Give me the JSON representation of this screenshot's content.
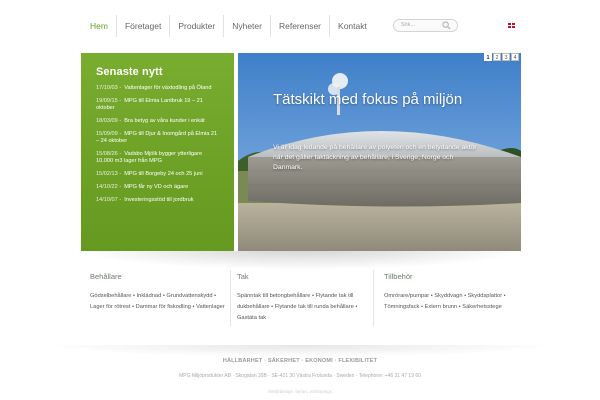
{
  "nav": {
    "items": [
      {
        "label": "Hem",
        "active": true
      },
      {
        "label": "Företaget",
        "active": false
      },
      {
        "label": "Produkter",
        "active": false
      },
      {
        "label": "Nyheter",
        "active": false
      },
      {
        "label": "Referenser",
        "active": false
      },
      {
        "label": "Kontakt",
        "active": false
      }
    ],
    "search_placeholder": "Sök...",
    "language_flag": "uk-flag-icon",
    "accent_color": "#6aa02b"
  },
  "news": {
    "title": "Senaste nytt",
    "background_color": "#6fa626",
    "items": [
      {
        "date": "17/10/03 -",
        "text": "Vattenlager för växtodling på Öland"
      },
      {
        "date": "19/09/15 -",
        "text": "MPG till Elmia Lantbruk 19 – 21 oktober"
      },
      {
        "date": "18/03/09 -",
        "text": "Bra betyg av våra kunder i enkät"
      },
      {
        "date": "15/09/09 -",
        "text": "MPG till Djur & Inomgård på Elmia 21 – 24 oktober"
      },
      {
        "date": "15/08/26 -",
        "text": "Vadsbo Mjölk bygger ytterligare 10.000 m3 lager från MPG"
      },
      {
        "date": "15/02/13 -",
        "text": "MPG till Borgeby 24 och 25 juni"
      },
      {
        "date": "14/10/22 -",
        "text": "MPG får ny VD och ägare"
      },
      {
        "date": "14/10/07 -",
        "text": "Investeringsstöd till jordbruk"
      }
    ]
  },
  "hero": {
    "title": "Tätskikt med fokus på miljön",
    "text": "Vi är idag ledande på behållare av polyeten och en betydande aktör när det gäller taktäckning av behållare, i Sverige, Norge och Danmark.",
    "pages": [
      "1",
      "2",
      "3",
      "4"
    ],
    "active_page": "1"
  },
  "columns": [
    {
      "title": "Behållare",
      "text": "Gödselbehållare • Inklädnad • Grundvattenskydd • Lager för rötrest • Dammar för fiskodling • Vattenlager"
    },
    {
      "title": "Tak",
      "text": "Spänntak till betongbehållare • Flytande tak till dukbehållare • Flytande tak till runda behållare • Gastäta tak"
    },
    {
      "title": "Tillbehör",
      "text": "Omrörare/pumpar • Skyddvagn • Skyddsplattor • Tömningsfack • Extern brunn • Säkerhetsstege"
    }
  ],
  "footer": {
    "tagline": "HÅLLBARHET · SÄKERHET · EKONOMI · FLEXIBILITET",
    "address": "MPG Miljöprodukter AB · Skogatan 35B · SE-421 30 Västra Frölunda · Sweden · Telephone: +46 31 47 19 60",
    "credit": "Webbdesign: byran, Jönköpings"
  }
}
